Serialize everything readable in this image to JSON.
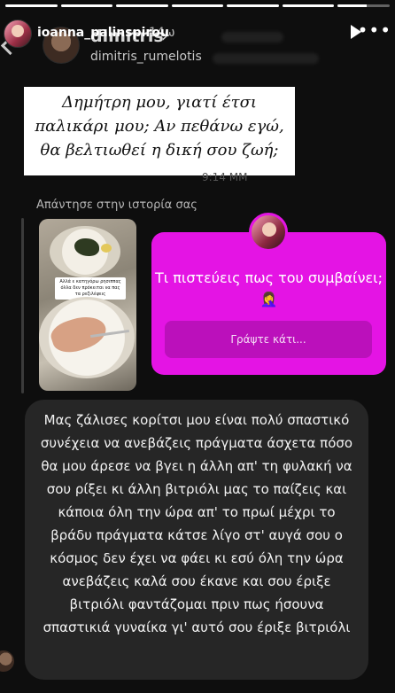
{
  "story": {
    "username": "ioanna_palinspirou",
    "time": "14ω",
    "progress": [
      1,
      1,
      1,
      1,
      1,
      1,
      0.55
    ],
    "icons": {
      "play": "play-icon",
      "more": "more-options-icon"
    }
  },
  "conversation": {
    "name": "dimitris",
    "chevron": "›",
    "handle": "dimitris_rumelotis"
  },
  "quote_card": {
    "lines": [
      "Δημήτρη μου, γιατί έτσι",
      "παλικάρι μου; Αν πεθάνω εγώ,",
      "θα βελτιωθεί η δική σου ζωή;"
    ]
  },
  "peek_text": "9:14 ΜΜ",
  "replied_label": "Απάντησε στην ιστορία σας",
  "story_thumb_caption": "Αλλά ε κατηγόρω ρησιππας όλλα δεν πρόκειται να πας τα ρεζιλέψεις",
  "question_card": {
    "text": "Τι πιστεύεις πως του συμβαίνει;🤦‍♀️",
    "input_placeholder": "Γράψτε κάτι..."
  },
  "reply_message": "Μας ζάλισες κορίτσι μου είναι πολύ σπαστικό συνέχεια να ανεβάζεις πράγματα άσχετα πόσο θα μου άρεσε να βγει η άλλη απ' τη φυλακή να σου ρίξει κι άλλη βιτριόλι μας το παίζεις και κάποια όλη την ώρα απ' το πρωί μέχρι το βράδυ πράγματα κάτσε λίγο στ' αυγά σου ο κόσμος δεν έχει να φάει κι εσύ όλη την ώρα ανεβάζεις καλά σου έκανε και σου έριξε βιτριόλι φαντάζομαι πριν πως ήσουνα σπαστικιά γυναίκα γι' αυτό σου έριξε βιτριόλι"
}
